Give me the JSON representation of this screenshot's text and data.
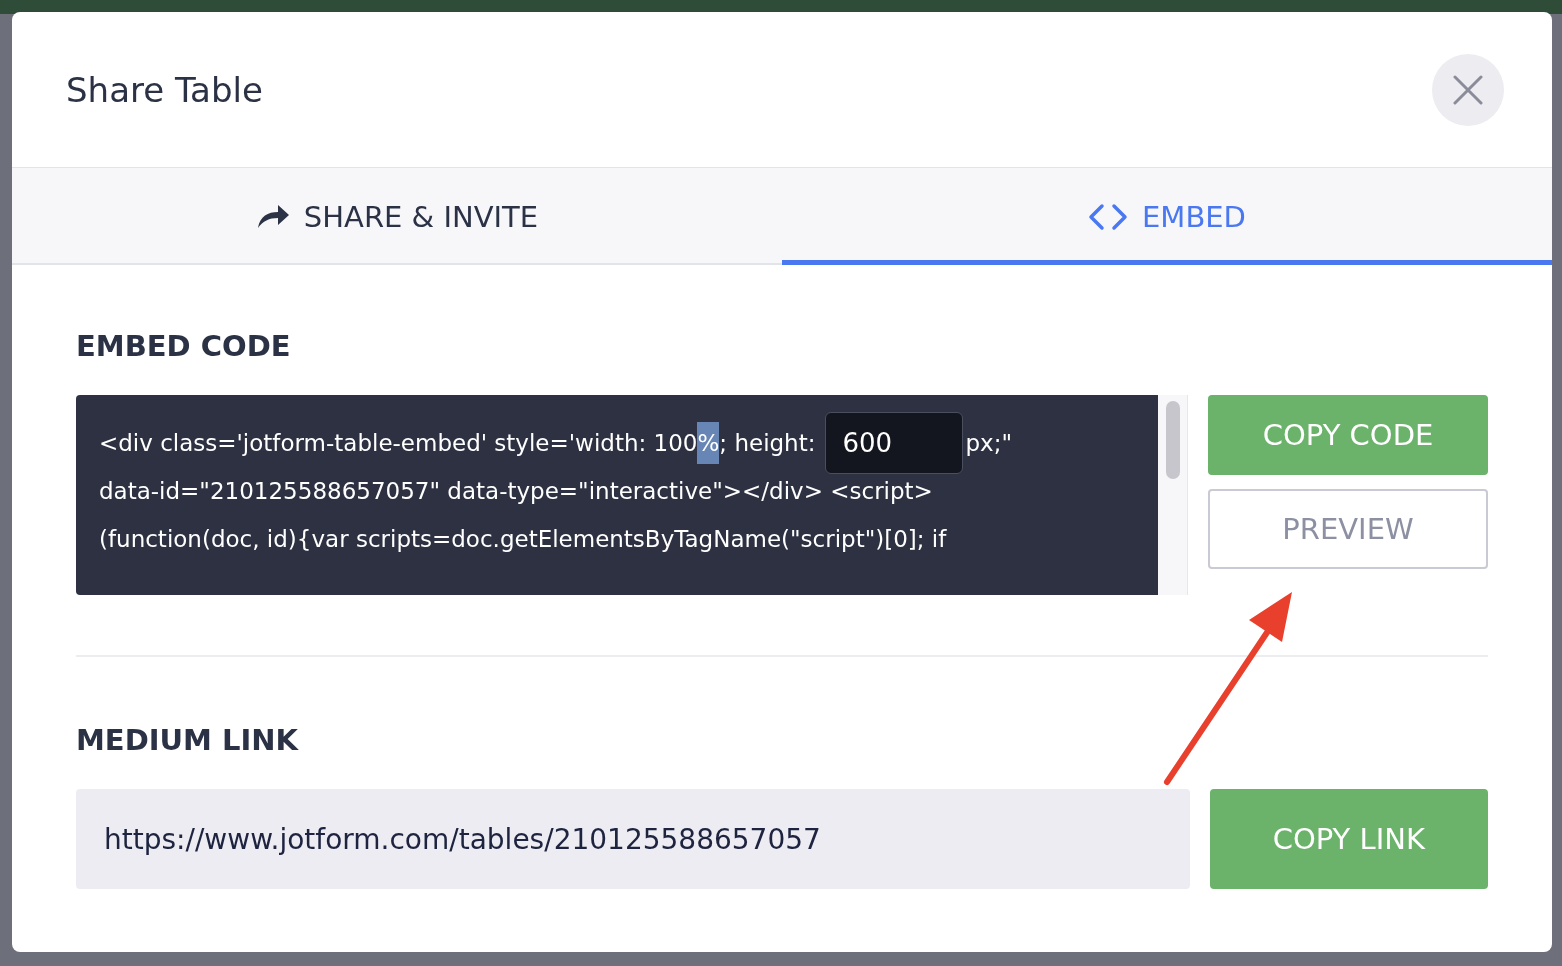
{
  "dialog": {
    "title": "Share Table"
  },
  "tabs": [
    {
      "label": "SHARE & INVITE",
      "kind": "share",
      "selected": false
    },
    {
      "label": "EMBED",
      "kind": "embed",
      "selected": true
    }
  ],
  "embed_code": {
    "label": "EMBED CODE",
    "lines": [
      {
        "segments": [
          {
            "kind": "text",
            "text": "<div class='jotform-table-embed' style='width: 100"
          },
          {
            "kind": "selection",
            "text": "%"
          },
          {
            "kind": "text",
            "text": "; height:"
          },
          {
            "kind": "field",
            "value": "600"
          },
          {
            "kind": "text",
            "text": "px;\""
          }
        ]
      },
      {
        "segments": [
          {
            "kind": "text",
            "text": "data-id=\"210125588657057\" data-type=\"interactive\"></div> <script>"
          }
        ]
      },
      {
        "segments": [
          {
            "kind": "text",
            "text": "(function(doc, id){var scripts=doc.getElementsByTagName(\"script\")[0]; if"
          }
        ]
      }
    ],
    "buttons": [
      {
        "label": "COPY CODE",
        "kind": "primary"
      },
      {
        "label": "PREVIEW",
        "kind": "outline"
      }
    ]
  },
  "medium_link": {
    "label": "MEDIUM LINK",
    "value": "https://www.jotform.com/tables/210125588657057",
    "button": "COPY LINK"
  }
}
